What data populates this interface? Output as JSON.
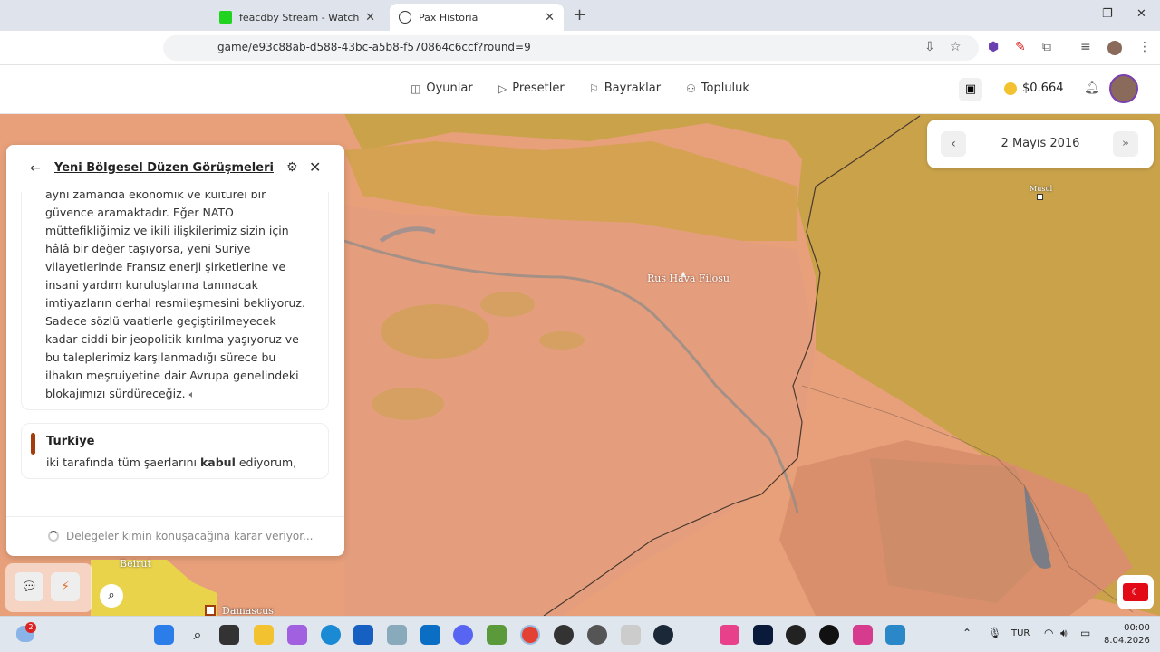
{
  "browser": {
    "tabs": [
      {
        "title": "feacdby Stream - Watch Live o",
        "active": false
      },
      {
        "title": "Pax Historia",
        "active": true
      }
    ],
    "url": "game/e93c88ab-d588-43bc-a5b8-f570864c6ccf?round=9"
  },
  "nav": {
    "items": [
      "Oyunlar",
      "Presetler",
      "Bayraklar",
      "Topluluk"
    ],
    "balance": "$0.664"
  },
  "date_panel": {
    "date": "2 Mayıs 2016"
  },
  "chat": {
    "title": "Yeni Bölgesel Düzen Görüşmeleri",
    "message1_lines": [
      "aynı zamanda ekonomik ve kültürel bir",
      "güvence aramaktadır. Eğer NATO",
      "müttefikliğimiz ve ikili ilişkilerimiz sizin için",
      "hâlâ bir değer taşıyorsa, yeni Suriye",
      "vilayetlerinde Fransız enerji şirketlerine ve",
      "insani yardım kuruluşlarına tanınacak",
      "imtiyazların derhal resmileşmesini bekliyoruz.",
      "Sadece sözlü vaatlerle geçiştirilmeyecek",
      "kadar ciddi bir jeopolitik kırılma yaşıyoruz ve",
      "bu taleplerimiz karşılanmadığı sürece bu",
      "ilhakın meşruiyetine dair Avrupa genelindeki",
      "blokajımızı sürdüreceğiz."
    ],
    "message2": {
      "speaker": "Turkiye",
      "text_before": "iki tarafında tüm şaerlarını ",
      "text_bold": "kabul",
      "text_after": " ediyorum,"
    },
    "status": "Delegeler kimin konuşacağına karar veriyor..."
  },
  "map": {
    "labels": {
      "fleet": "Rus Hava Filosu",
      "mosul": "Musul",
      "beirut": "Beirut",
      "damascus": "Damascus"
    }
  },
  "taskbar": {
    "badge": "2",
    "lang": "TUR",
    "time": "00:00",
    "date": "8.04.2026"
  },
  "colors": {
    "player_flag": "#e30a17",
    "turkiye_accent": "#a33d0c"
  }
}
